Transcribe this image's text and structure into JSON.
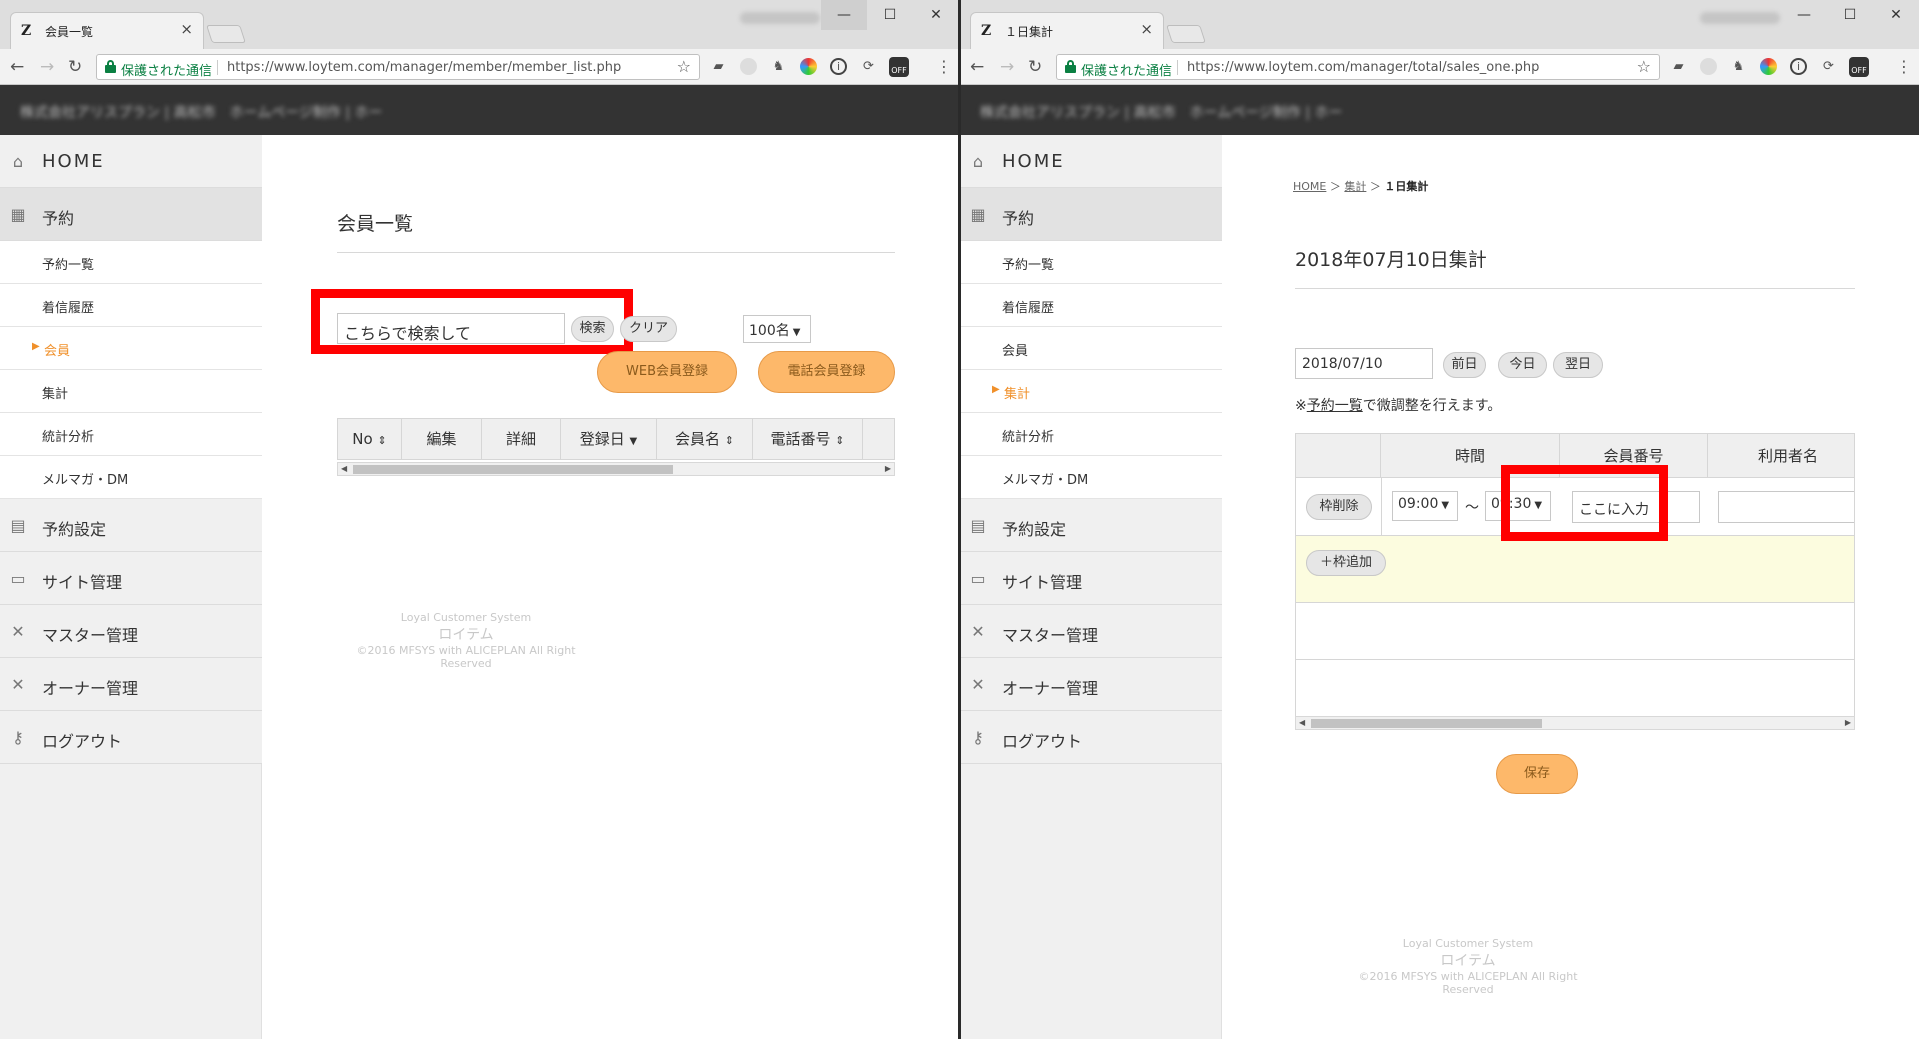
{
  "left": {
    "tab_title": "会員一覧",
    "tab_favicon": "Z",
    "secure_label": "保護された通信",
    "url": "https://www.loytem.com/manager/member/member_list.php",
    "page_title": "会員一覧",
    "search": {
      "value": "こちらで検索して",
      "search_button": "検索",
      "clear_button": "クリア"
    },
    "per_page": "100名",
    "web_register_button": "WEB会員登録",
    "phone_register_button": "電話会員登録",
    "table_columns": [
      "No",
      "編集",
      "詳細",
      "登録日",
      "会員名",
      "電話番号"
    ],
    "footer": {
      "line1": "Loyal Customer System",
      "line2": "ロイテム",
      "line3": "©2016 MFSYS with ALICEPLAN All Right Reserved"
    }
  },
  "right": {
    "tab_title": "１日集計",
    "tab_favicon": "Z",
    "secure_label": "保護された通信",
    "url": "https://www.loytem.com/manager/total/sales_one.php",
    "breadcrumb": {
      "home": "HOME",
      "sep1": "＞",
      "total": "集計",
      "sep2": "＞",
      "current": "１日集計"
    },
    "page_title": "2018年07月10日集計",
    "date_value": "2018/07/10",
    "prev_day": "前日",
    "today": "今日",
    "next_day": "翌日",
    "note_link": "予約一覧",
    "note_prefix": "※",
    "note_suffix": "で微調整を行えます。",
    "table_columns": [
      "時間",
      "会員番号",
      "利用者名"
    ],
    "delete_frame_button": "枠削除",
    "time_from": "09:00",
    "time_tilde": "〜",
    "time_to": "09:30",
    "member_no_value": "ここに入力",
    "add_frame_button": "＋枠追加",
    "save_button": "保存",
    "footer": {
      "line1": "Loyal Customer System",
      "line2": "ロイテム",
      "line3": "©2016 MFSYS with ALICEPLAN All Right Reserved"
    }
  },
  "sidebar": {
    "home": "HOME",
    "reservation": "予約",
    "reservation_list": "予約一覧",
    "incoming_history": "着信履歴",
    "member": "会員",
    "total": "集計",
    "stats": "統計分析",
    "mailmag": "メルマガ・DM",
    "reservation_settings": "予約設定",
    "site_management": "サイト管理",
    "master_management": "マスター管理",
    "owner_management": "オーナー管理",
    "logout": "ログアウト",
    "active_marker": "▶"
  },
  "header_blurred": "株式会社アリスプラン | 高松市　ホームページ制作 | ホー",
  "icons": {
    "home": "home-icon",
    "reservation": "calendar-icon",
    "settings": "settings-icon",
    "site": "monitor-icon",
    "master": "tools-icon",
    "owner": "tools-icon",
    "logout": "key-icon"
  },
  "colors": {
    "accent_orange": "#f0902a",
    "button_orange": "#fdb86a",
    "highlight_red": "#ff0000",
    "header_dark": "#333333",
    "secure_green": "#0b8043"
  }
}
